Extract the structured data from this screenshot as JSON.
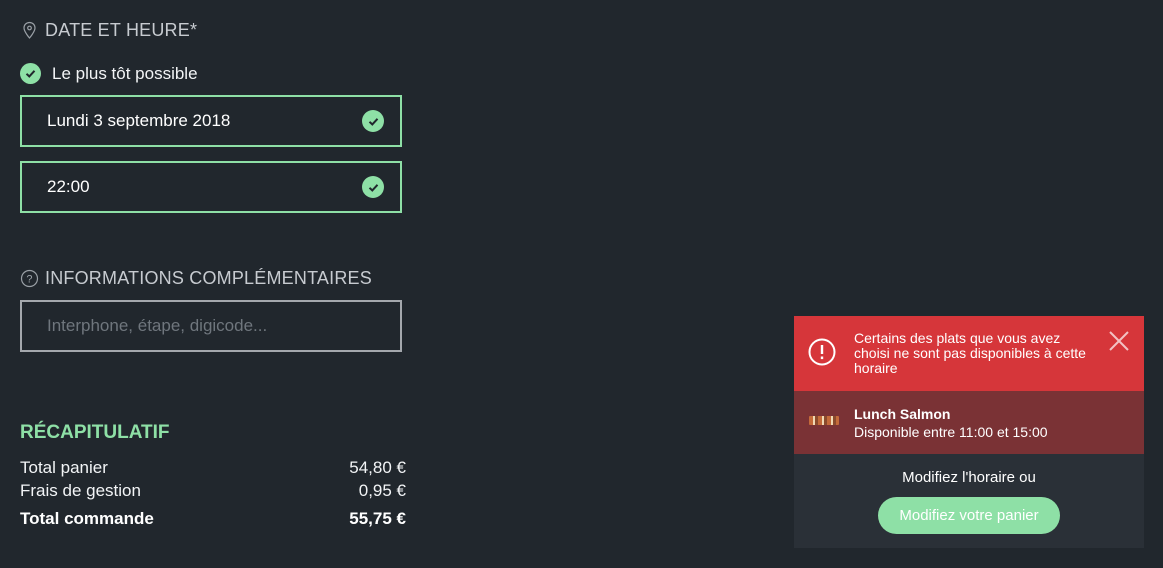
{
  "datetime": {
    "title": "DATE ET HEURE*",
    "asap_label": "Le plus tôt possible",
    "date_value": "Lundi 3 septembre 2018",
    "time_value": "22:00"
  },
  "info": {
    "title": "INFORMATIONS COMPLÉMENTAIRES",
    "placeholder": "Interphone, étape, digicode..."
  },
  "recap": {
    "title": "RÉCAPITULATIF",
    "rows": [
      {
        "label": "Total panier",
        "value": "54,80 €"
      },
      {
        "label": "Frais de gestion",
        "value": "0,95 €"
      }
    ],
    "total": {
      "label": "Total commande",
      "value": "55,75 €"
    }
  },
  "alert": {
    "message": "Certains des plats que vous avez choisi ne sont pas disponibles à cette horaire",
    "item_name": "Lunch Salmon",
    "item_availability": "Disponible entre 11:00 et 15:00",
    "footer_text": "Modifiez l'horaire ou",
    "button_label": "Modifiez votre panier"
  },
  "colors": {
    "background": "#21272d",
    "accent_green": "#8ee0a6",
    "alert_red": "#d6363a",
    "alert_item_bg": "#7a3235"
  },
  "icons": [
    "location-pin-icon",
    "check-icon",
    "question-icon",
    "alert-icon",
    "close-icon"
  ]
}
